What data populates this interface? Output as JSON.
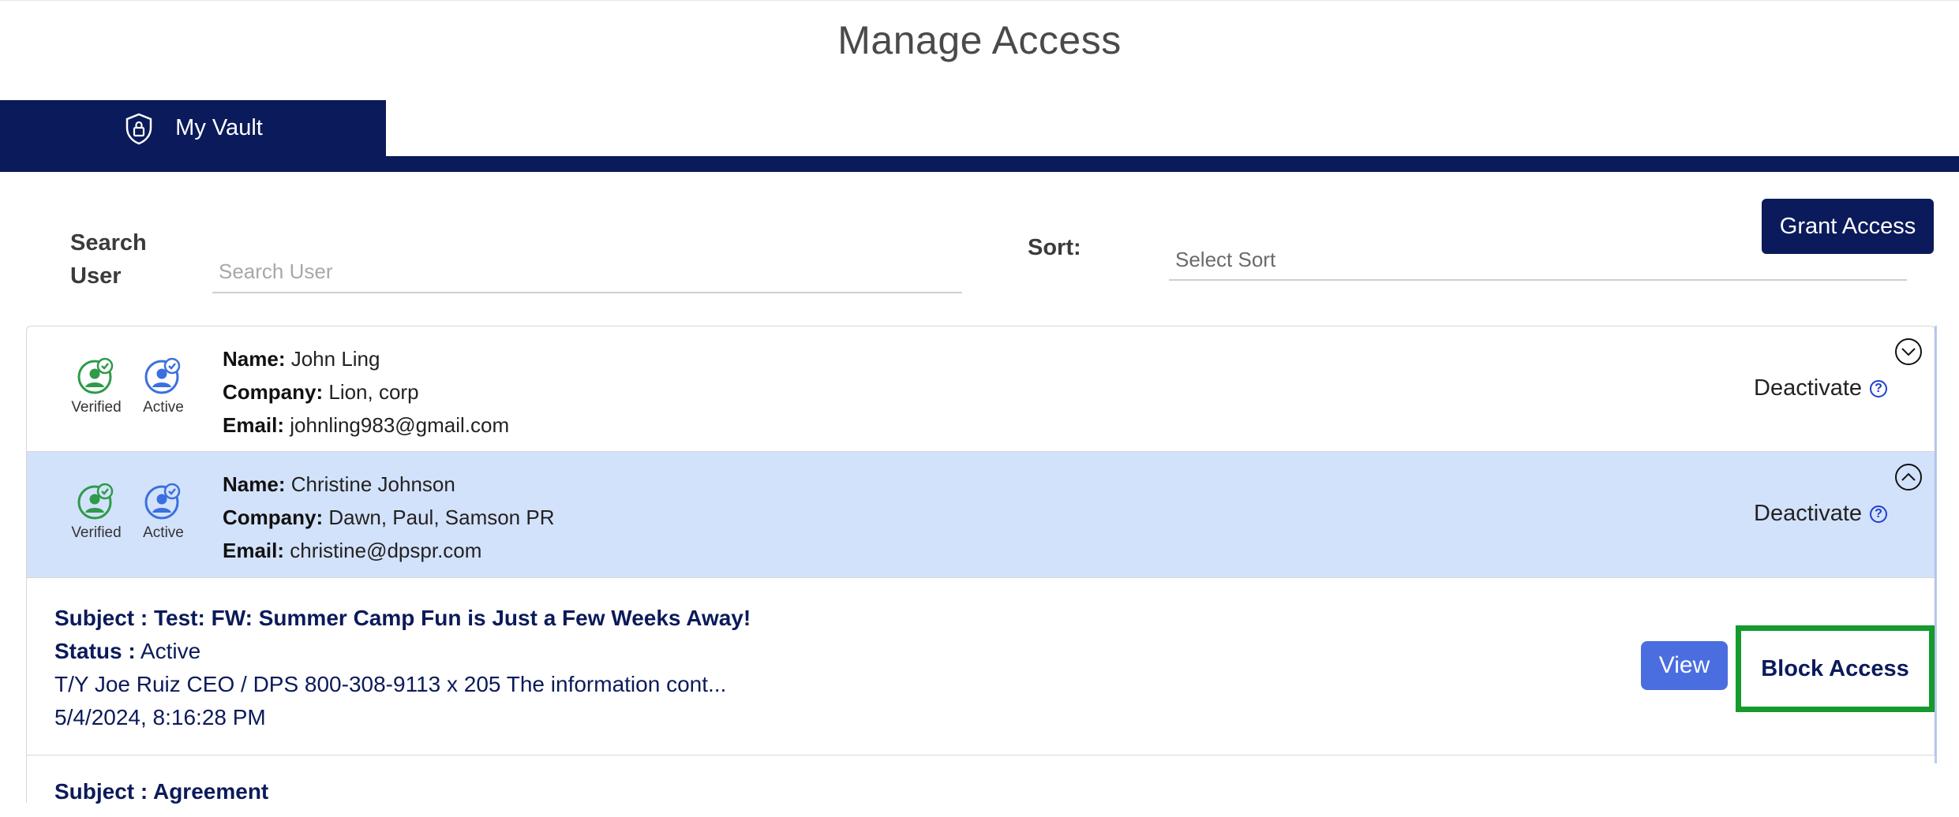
{
  "page": {
    "title": "Manage Access"
  },
  "tabs": [
    {
      "label": "My Vault",
      "icon": "shield-lock-icon",
      "active": true
    }
  ],
  "filters": {
    "search_label": "Search User",
    "search_placeholder": "Search User",
    "sort_label": "Sort:",
    "sort_placeholder": "Select Sort",
    "grant_button": "Grant Access"
  },
  "users": [
    {
      "badges": [
        {
          "label": "Verified",
          "color": "#2e9a4a"
        },
        {
          "label": "Active",
          "color": "#3b6fe0"
        }
      ],
      "name_label": "Name:",
      "name": "John Ling",
      "company_label": "Company:",
      "company": "Lion, corp",
      "email_label": "Email:",
      "email": "johnling983@gmail.com",
      "action": "Deactivate",
      "expanded": false
    },
    {
      "badges": [
        {
          "label": "Verified",
          "color": "#2e9a4a"
        },
        {
          "label": "Active",
          "color": "#3b6fe0"
        }
      ],
      "name_label": "Name:",
      "name": "Christine Johnson",
      "company_label": "Company:",
      "company": "Dawn, Paul, Samson PR",
      "email_label": "Email:",
      "email": "christine@dpspr.com",
      "action": "Deactivate",
      "expanded": true
    }
  ],
  "messages": [
    {
      "subject_label": "Subject :",
      "subject": "Test: FW: Summer Camp Fun is Just a Few Weeks Away!",
      "status_label": "Status :",
      "status": "Active",
      "preview": "T/Y Joe Ruiz CEO / DPS 800-308-9113 x 205 The information cont...",
      "date": "5/4/2024, 8:16:28 PM",
      "view_button": "View",
      "block_button": "Block Access"
    },
    {
      "subject_label": "Subject :",
      "subject": "Agreement"
    }
  ],
  "colors": {
    "navy": "#0b1a5a",
    "selected_row": "#d3e2fb",
    "view_button": "#4a6ee0",
    "highlight_border": "#159a2c"
  }
}
